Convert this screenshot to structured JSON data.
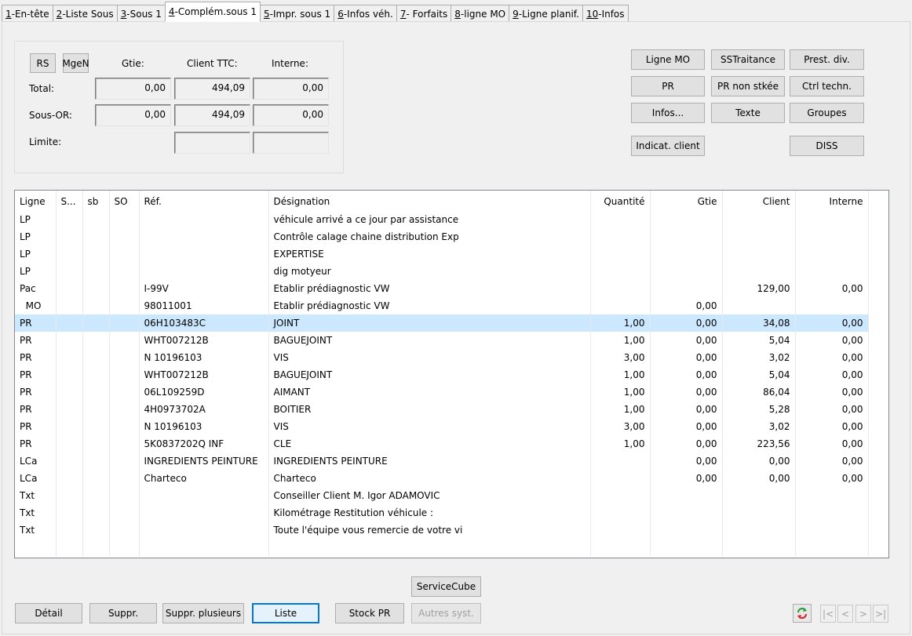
{
  "tabs": [
    {
      "num": "1",
      "label": "-En-tête"
    },
    {
      "num": "2",
      "label": "-Liste Sous"
    },
    {
      "num": "3",
      "label": "-Sous 1"
    },
    {
      "num": "4",
      "label": "-Complém.sous 1"
    },
    {
      "num": "5",
      "label": "-Impr. sous 1"
    },
    {
      "num": "6",
      "label": "-Infos véh."
    },
    {
      "num": "7",
      "label": "- Forfaits"
    },
    {
      "num": "8",
      "label": "-ligne MO"
    },
    {
      "num": "9",
      "label": "-Ligne planif."
    },
    {
      "num": "10",
      "label": "-Infos"
    }
  ],
  "totals": {
    "rs_label": "RS",
    "mgen_label": "MgeN",
    "col_gtie": "Gtie:",
    "col_client": "Client TTC:",
    "col_interne": "Interne:",
    "row_total": "Total:",
    "row_sousor": "Sous-OR:",
    "row_limite": "Limite:",
    "total_gtie": "0,00",
    "total_client": "494,09",
    "total_interne": "0,00",
    "sousor_gtie": "0,00",
    "sousor_client": "494,09",
    "sousor_interne": "0,00",
    "limite_client": "",
    "limite_interne": ""
  },
  "actions": {
    "ligne_mo": "Ligne MO",
    "sstraitance": "SSTraitance",
    "prest_div": "Prest. div.",
    "pr": "PR",
    "pr_non_stkee": "PR non stkée",
    "ctrl_techn": "Ctrl techn.",
    "infos": "Infos...",
    "texte": "Texte",
    "groupes": "Groupes",
    "indicat_client": "Indicat. client",
    "diss": "DISS"
  },
  "grid": {
    "headers": [
      "Ligne",
      "S...",
      "sb",
      "SO",
      "Réf.",
      "Désignation",
      "Quantité",
      "Gtie",
      "Client",
      "Interne"
    ],
    "rows": [
      [
        "LP",
        "",
        "",
        "",
        "",
        "véhicule arrivé a ce jour par assistance",
        "",
        "",
        "",
        ""
      ],
      [
        "LP",
        "",
        "",
        "",
        "",
        "Contrôle calage chaine distribution Exp",
        "",
        "",
        "",
        ""
      ],
      [
        "LP",
        "",
        "",
        "",
        "",
        "EXPERTISE",
        "",
        "",
        "",
        ""
      ],
      [
        "LP",
        "",
        "",
        "",
        "",
        "dig motyeur",
        "",
        "",
        "",
        ""
      ],
      [
        "Pac",
        "",
        "",
        "",
        "I-99V",
        "Etablir prédiagnostic VW",
        "",
        "",
        "129,00",
        "0,00"
      ],
      [
        "  MO",
        "",
        "",
        "",
        "98011001",
        "Etablir prédiagnostic VW",
        "",
        "0,00",
        "",
        ""
      ],
      [
        "PR",
        "",
        "",
        "",
        "06H103483C",
        "JOINT",
        "1,00",
        "0,00",
        "34,08",
        "0,00"
      ],
      [
        "PR",
        "",
        "",
        "",
        "WHT007212B",
        "BAGUEJOINT",
        "1,00",
        "0,00",
        "5,04",
        "0,00"
      ],
      [
        "PR",
        "",
        "",
        "",
        "N  10196103",
        "VIS",
        "3,00",
        "0,00",
        "3,02",
        "0,00"
      ],
      [
        "PR",
        "",
        "",
        "",
        "WHT007212B",
        "BAGUEJOINT",
        "1,00",
        "0,00",
        "5,04",
        "0,00"
      ],
      [
        "PR",
        "",
        "",
        "",
        "06L109259D",
        "AIMANT",
        "1,00",
        "0,00",
        "86,04",
        "0,00"
      ],
      [
        "PR",
        "",
        "",
        "",
        "4H0973702A",
        "BOITIER",
        "1,00",
        "0,00",
        "5,28",
        "0,00"
      ],
      [
        "PR",
        "",
        "",
        "",
        "N  10196103",
        "VIS",
        "3,00",
        "0,00",
        "3,02",
        "0,00"
      ],
      [
        "PR",
        "",
        "",
        "",
        "5K0837202Q INF",
        "CLE",
        "1,00",
        "0,00",
        "223,56",
        "0,00"
      ],
      [
        "LCa",
        "",
        "",
        "",
        "INGREDIENTS PEINTURE",
        "INGREDIENTS PEINTURE",
        "",
        "0,00",
        "0,00",
        "0,00"
      ],
      [
        "LCa",
        "",
        "",
        "",
        "Charteco",
        "Charteco",
        "",
        "0,00",
        "0,00",
        "0,00"
      ],
      [
        "Txt",
        "",
        "",
        "",
        "",
        "Conseiller Client M. Igor ADAMOVIC",
        "",
        "",
        "",
        ""
      ],
      [
        "Txt",
        "",
        "",
        "",
        "",
        "Kilométrage Restitution véhicule :",
        "",
        "",
        "",
        ""
      ],
      [
        "Txt",
        "",
        "",
        "",
        "",
        "Toute l'équipe vous remercie de votre vi",
        "",
        "",
        "",
        ""
      ]
    ],
    "selected_row": 6
  },
  "bottom": {
    "servicecube": "ServiceCube",
    "detail": "Détail",
    "suppr": "Suppr.",
    "suppr_plusieurs": "Suppr. plusieurs",
    "liste": "Liste",
    "stock_pr": "Stock PR",
    "autres_syst": "Autres syst.",
    "nav_first": "|<",
    "nav_prev": "<",
    "nav_next": ">",
    "nav_last": ">|"
  },
  "icons": {
    "refresh": "refresh-icon"
  },
  "colors": {
    "selected_row": "#cce8ff",
    "focus_border": "#0078d7"
  }
}
